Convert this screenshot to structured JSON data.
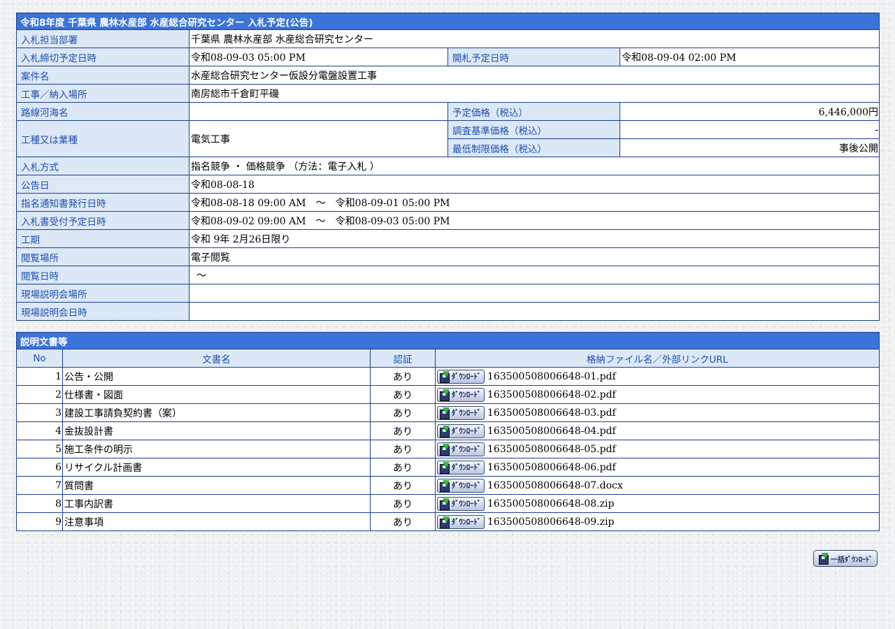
{
  "info": {
    "title": "令和8年度 千葉県 農林水産部 水産総合研究センター 入札予定(公告)",
    "dept_label": "入札担当部署",
    "dept_value": "千葉県 農林水産部 水産総合研究センター",
    "deadline_label": "入札締切予定日時",
    "deadline_value": "令和08-09-03 05:00 PM",
    "opening_label": "開札予定日時",
    "opening_value": "令和08-09-04 02:00 PM",
    "case_label": "案件名",
    "case_value": "水産総合研究センター仮設分電盤設置工事",
    "place_label": "工事／納入場所",
    "place_value": "南房総市千倉町平磯",
    "route_label": "路線河海名",
    "route_value": "",
    "planned_price_label": "予定価格（税込）",
    "planned_price_value": "6,446,000円",
    "type_label": "工種又は業種",
    "type_value": "電気工事",
    "survey_price_label": "調査基準価格（税込）",
    "survey_price_value": "-",
    "min_price_label": "最低制限価格（税込）",
    "min_price_value": "事後公開",
    "method_label": "入札方式",
    "method_value": "指名競争 ・ 価格競争 （方法：電子入札 ）",
    "notice_date_label": "公告日",
    "notice_date_value": "令和08-08-18",
    "designation_label": "指名通知書発行日時",
    "designation_value": "令和08-08-18 09:00 AM　～　令和08-09-01 05:00 PM",
    "reception_label": "入札書受付予定日時",
    "reception_value": "令和08-09-02 09:00 AM　～　令和08-09-03 05:00 PM",
    "period_label": "工期",
    "period_value": "令和 9年 2月26日限り",
    "viewing_place_label": "閲覧場所",
    "viewing_place_value": "電子閲覧",
    "viewing_date_label": "閲覧日時",
    "viewing_date_value": "～",
    "site_place_label": "現場説明会場所",
    "site_place_value": "",
    "site_date_label": "現場説明会日時",
    "site_date_value": ""
  },
  "docs": {
    "title": "説明文書等",
    "col_no": "No",
    "col_name": "文書名",
    "col_cert": "認証",
    "col_file": "格納ファイル名／外部リンクURL",
    "download_label": "ﾀﾞｳﾝﾛｰﾄﾞ",
    "rows": [
      {
        "no": "1",
        "name": "公告・公開",
        "cert": "あり",
        "file": "163500508006648-01.pdf"
      },
      {
        "no": "2",
        "name": "仕様書・図面",
        "cert": "あり",
        "file": "163500508006648-02.pdf"
      },
      {
        "no": "3",
        "name": "建設工事請負契約書（案）",
        "cert": "あり",
        "file": "163500508006648-03.pdf"
      },
      {
        "no": "4",
        "name": "金抜設計書",
        "cert": "あり",
        "file": "163500508006648-04.pdf"
      },
      {
        "no": "5",
        "name": "施工条件の明示",
        "cert": "あり",
        "file": "163500508006648-05.pdf"
      },
      {
        "no": "6",
        "name": "リサイクル計画書",
        "cert": "あり",
        "file": "163500508006648-06.pdf"
      },
      {
        "no": "7",
        "name": "質問書",
        "cert": "あり",
        "file": "163500508006648-07.docx"
      },
      {
        "no": "8",
        "name": "工事内訳書",
        "cert": "あり",
        "file": "163500508006648-08.zip"
      },
      {
        "no": "9",
        "name": "注意事項",
        "cert": "あり",
        "file": "163500508006648-09.zip"
      }
    ]
  },
  "bulk_download_label": "一括ﾀﾞｳﾝﾛｰﾄﾞ",
  "icons": {
    "download": "download-icon",
    "bulk_download": "bulk-download-icon"
  }
}
